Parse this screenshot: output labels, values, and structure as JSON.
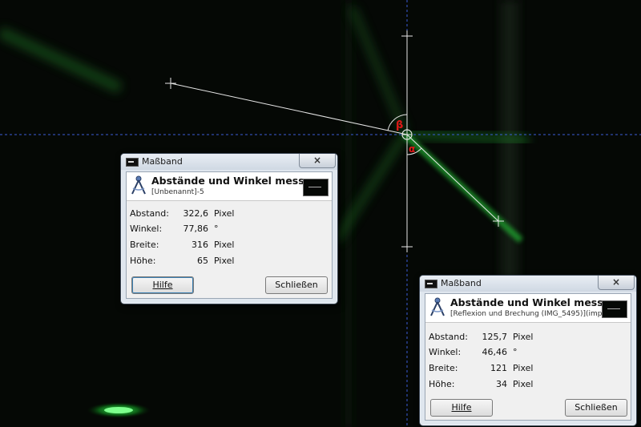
{
  "canvas": {
    "angle_beta_symbol": "β",
    "angle_alpha_symbol": "α",
    "guide_color": "#3a5bd8",
    "measure_line_color": "#e0e0e0",
    "angle_color": "#e01818",
    "laser_color": "#22cc33"
  },
  "dialogs": [
    {
      "title": "Maßband",
      "close_label": "×",
      "header_title": "Abstände und Winkel messen",
      "header_subtitle": "[Unbenannt]-5",
      "rows": [
        {
          "label": "Abstand:",
          "value": "322,6",
          "unit": "Pixel"
        },
        {
          "label": "Winkel:",
          "value": "77,86",
          "unit": "°"
        },
        {
          "label": "Breite:",
          "value": "316",
          "unit": "Pixel"
        },
        {
          "label": "Höhe:",
          "value": "65",
          "unit": "Pixel"
        }
      ],
      "help_label": "Hilfe",
      "close_button_label": "Schließen"
    },
    {
      "title": "Maßband",
      "close_label": "×",
      "header_title": "Abstände und Winkel messen",
      "header_subtitle": "[Reflexion und Brechung (IMG_5495)](imp...",
      "rows": [
        {
          "label": "Abstand:",
          "value": "125,7",
          "unit": "Pixel"
        },
        {
          "label": "Winkel:",
          "value": "46,46",
          "unit": "°"
        },
        {
          "label": "Breite:",
          "value": "121",
          "unit": "Pixel"
        },
        {
          "label": "Höhe:",
          "value": "34",
          "unit": "Pixel"
        }
      ],
      "help_label": "Hilfe",
      "close_button_label": "Schließen"
    }
  ]
}
